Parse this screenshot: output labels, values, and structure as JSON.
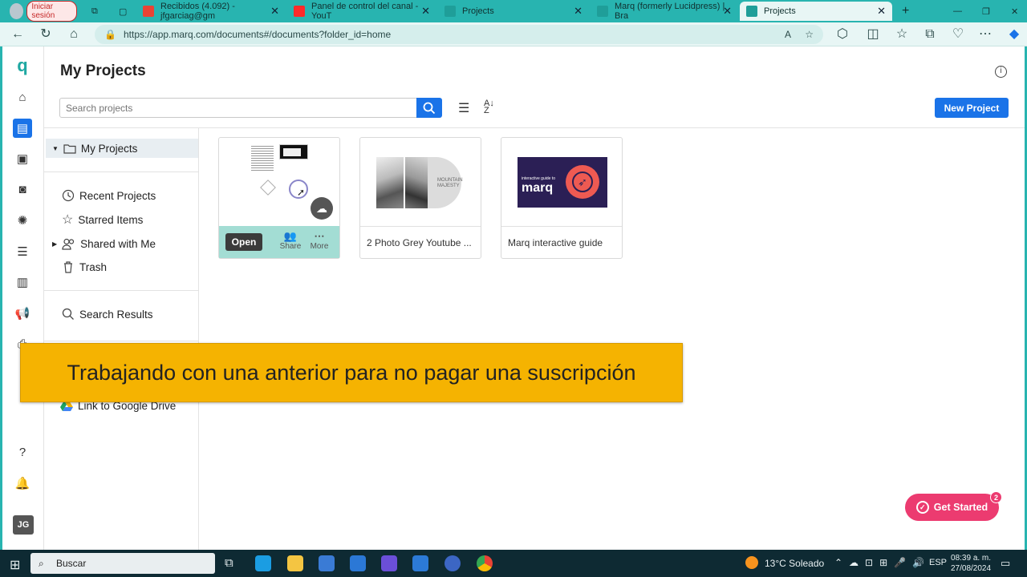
{
  "browser": {
    "tabs": [
      {
        "label": "Iniciar sesión"
      },
      {
        "label": "Recibidos (4.092) - jfgarciag@gm"
      },
      {
        "label": "Panel de control del canal - YouT"
      },
      {
        "label": "Projects"
      },
      {
        "label": "Marq (formerly Lucidpress) | Bra"
      },
      {
        "label": "Projects"
      }
    ],
    "url": "https://app.marq.com/documents#/documents?folder_id=home"
  },
  "app": {
    "logo": "q",
    "page_title": "My Projects",
    "search_placeholder": "Search projects",
    "new_project_label": "New Project",
    "sidebar": {
      "my_projects": "My Projects",
      "recent": "Recent Projects",
      "starred": "Starred Items",
      "shared": "Shared with Me",
      "trash": "Trash",
      "search_results": "Search Results",
      "google_drive": "Link to Google Drive"
    },
    "cards": [
      {
        "label": "",
        "open": "Open",
        "share": "Share",
        "more": "More"
      },
      {
        "label": "2 Photo Grey Youtube ...",
        "thumb_text": "MOUNTAIN MAJESTY"
      },
      {
        "label": "Marq interactive guide",
        "thumb_kicker": "interactive guide to",
        "thumb_word": "marq"
      }
    ],
    "user_initials": "JG",
    "get_started": "Get Started",
    "get_started_count": "2"
  },
  "caption": "Trabajando con una anterior para no pagar una suscripción",
  "taskbar": {
    "search": "Buscar",
    "weather": "13°C  Soleado",
    "lang": "ESP",
    "time": "08:39 a. m.",
    "date": "27/08/2024"
  },
  "colors": {
    "accent": "#28b4b0",
    "primary_button": "#1a73e8",
    "caption_bg": "#f5b301",
    "get_started": "#ec3b70"
  }
}
